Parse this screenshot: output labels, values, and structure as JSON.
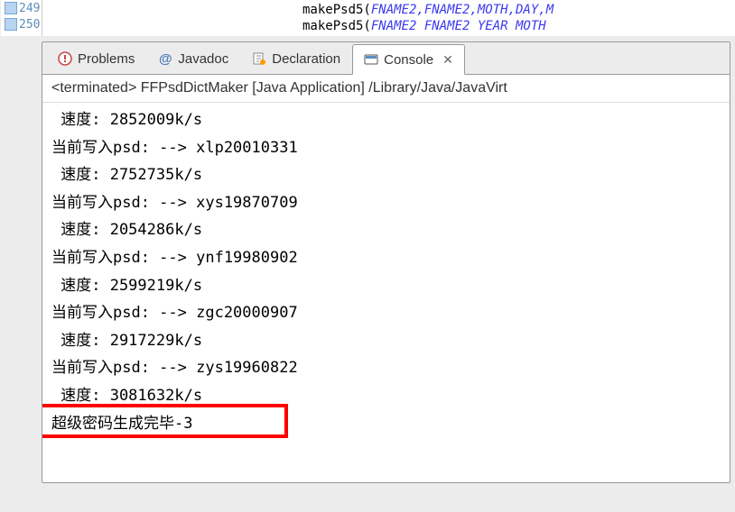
{
  "editor": {
    "gutter": [
      {
        "num": "249"
      },
      {
        "num": "250"
      }
    ],
    "lines": [
      {
        "fn": "makePsd5(",
        "params": "FNAME2,FNAME2,MOTH,DAY,M"
      },
      {
        "fn": "makePsd5(",
        "params": "FNAME2 FNAME2 YEAR MOTH "
      }
    ]
  },
  "tabs": {
    "problems": {
      "label": "Problems"
    },
    "javadoc": {
      "label": "Javadoc"
    },
    "declaration": {
      "label": "Declaration"
    },
    "console": {
      "label": "Console"
    }
  },
  "status": "<terminated> FFPsdDictMaker [Java Application] /Library/Java/JavaVirt",
  "console": {
    "lines": [
      " 速度: 2852009k/s",
      "当前写入psd: --> xlp20010331",
      " 速度: 2752735k/s",
      "当前写入psd: --> xys19870709",
      " 速度: 2054286k/s",
      "当前写入psd: --> ynf19980902",
      " 速度: 2599219k/s",
      "当前写入psd: --> zgc20000907",
      " 速度: 2917229k/s",
      "当前写入psd: --> zys19960822",
      " 速度: 3081632k/s",
      "超级密码生成完毕-3"
    ]
  }
}
